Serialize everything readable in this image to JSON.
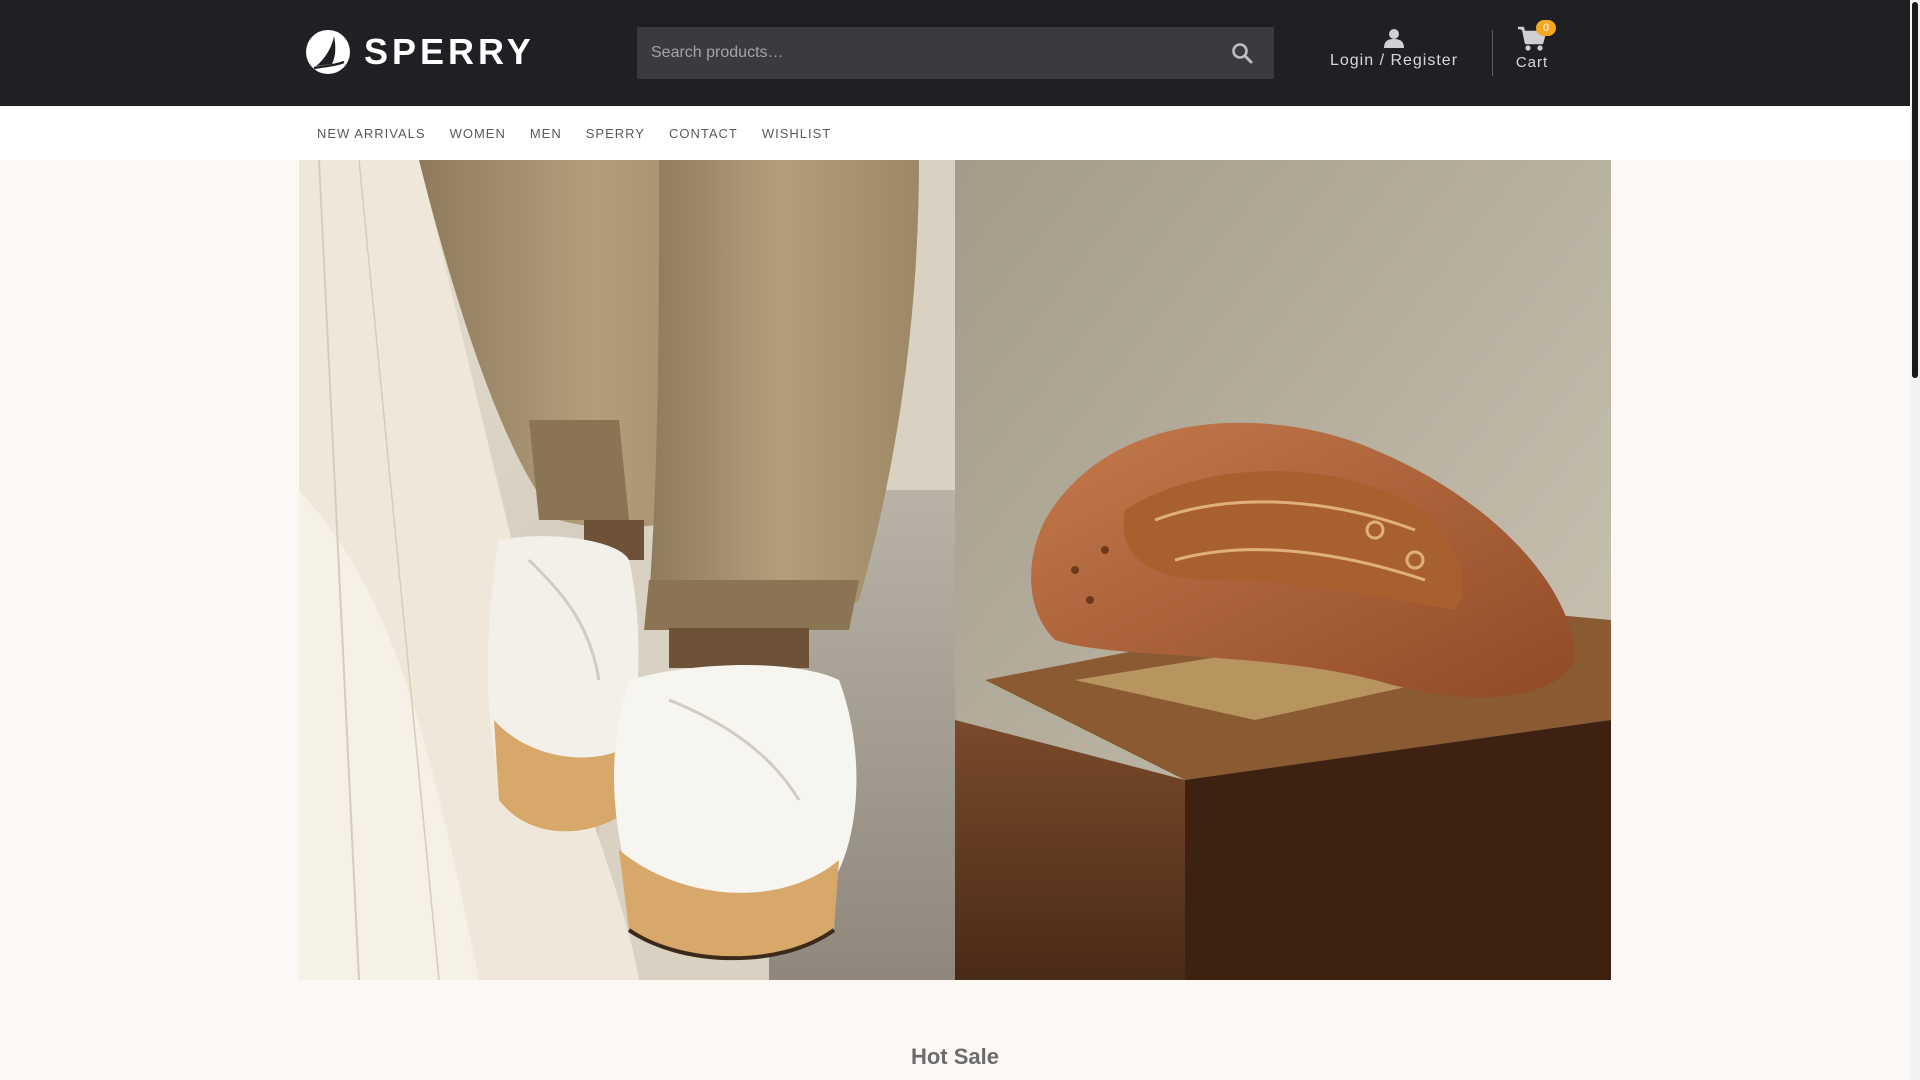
{
  "brand": {
    "name": "SPERRY",
    "logo_icon": "sail-icon"
  },
  "search": {
    "placeholder": "Search products…",
    "icon": "search-icon"
  },
  "account": {
    "label": "Login / Register",
    "icon": "user-icon"
  },
  "cart": {
    "label": "Cart",
    "count": "0",
    "icon": "cart-icon"
  },
  "nav": {
    "items": [
      {
        "label": "NEW ARRIVALS"
      },
      {
        "label": "WOMEN"
      },
      {
        "label": "MEN"
      },
      {
        "label": "SPERRY"
      },
      {
        "label": "CONTACT"
      },
      {
        "label": "WISHLIST"
      }
    ]
  },
  "hero": {
    "left_image": "white-sneakers-khaki-pants-photo",
    "right_image": "brown-leather-loafers-on-wooden-stool-photo"
  },
  "sections": {
    "hot_sale_title": "Hot Sale"
  },
  "colors": {
    "header_bg": "#1f2024",
    "page_bg": "#fcf8f5",
    "badge": "#f5a623",
    "search_bg": "#3a3b3f"
  }
}
